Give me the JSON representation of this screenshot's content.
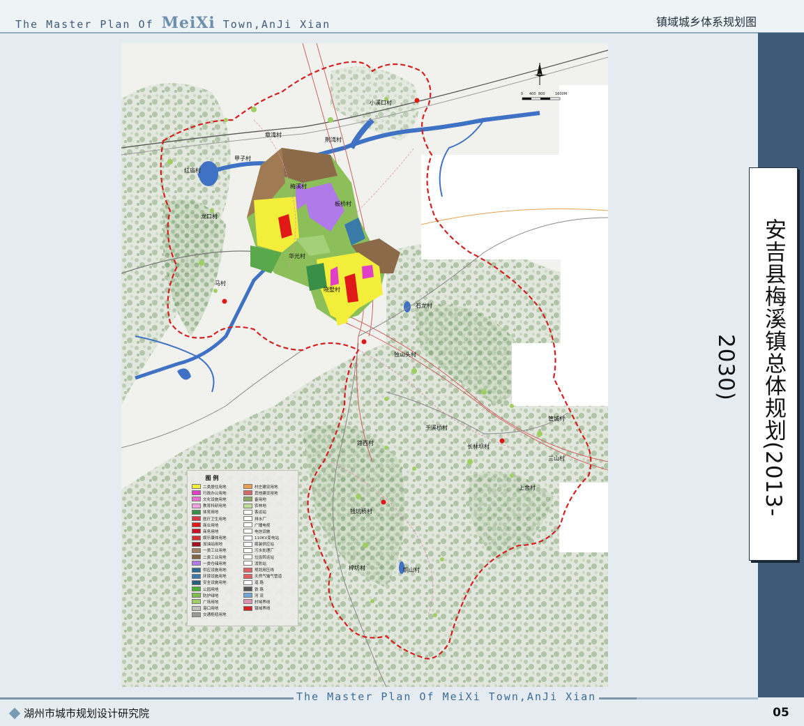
{
  "header": {
    "title_prefix": "The Master Plan Of ",
    "title_brand": "MeiXi",
    "title_suffix": " Town,AnJi Xian",
    "right_title": "镇域城乡体系规划图"
  },
  "side_title": "安吉县梅溪镇总体规划(2013-2030)",
  "map": {
    "scale_labels": [
      "0",
      "400",
      "800",
      "1600M"
    ],
    "villages": [
      {
        "name": "小溪口村"
      },
      {
        "name": "荆湾村"
      },
      {
        "name": "章湾村"
      },
      {
        "name": "甲子村"
      },
      {
        "name": "红庙村"
      },
      {
        "name": "梅溪村"
      },
      {
        "name": "板桥村"
      },
      {
        "name": "龙口村"
      },
      {
        "name": "华光村"
      },
      {
        "name": "晓墅村"
      },
      {
        "name": "马村"
      },
      {
        "name": "石龙村"
      },
      {
        "name": "独山头村"
      },
      {
        "name": "管城村"
      },
      {
        "name": "千溪桥村"
      },
      {
        "name": "长林坝村"
      },
      {
        "name": "路西村"
      },
      {
        "name": "三山村"
      },
      {
        "name": "上舍村"
      },
      {
        "name": "钱坑桥村"
      },
      {
        "name": "梓坊村"
      },
      {
        "name": "铜山村"
      }
    ],
    "legend": {
      "title": "图  例",
      "left": [
        {
          "label": "二类居住用地",
          "color": "#f2ee3a"
        },
        {
          "label": "行政办公用地",
          "color": "#e040c8"
        },
        {
          "label": "文化设施用地",
          "color": "#e86fd0"
        },
        {
          "label": "教育科研用地",
          "color": "#f3a2e0"
        },
        {
          "label": "体育用地",
          "color": "#3a8f48"
        },
        {
          "label": "医疗卫生用地",
          "color": "#d63848"
        },
        {
          "label": "商业用地",
          "color": "#e01818"
        },
        {
          "label": "商务用地",
          "color": "#c8102a"
        },
        {
          "label": "娱乐康体用地",
          "color": "#d43232"
        },
        {
          "label": "加油站用地",
          "color": "#a51020"
        },
        {
          "label": "一类工业用地",
          "color": "#a08064"
        },
        {
          "label": "二类工业用地",
          "color": "#866442"
        },
        {
          "label": "一类仓储用地",
          "color": "#b07ae8"
        },
        {
          "label": "供应设施用地",
          "color": "#2a6a90"
        },
        {
          "label": "环境设施用地",
          "color": "#3a7aa8"
        },
        {
          "label": "安全设施用地",
          "color": "#2a5f7a"
        },
        {
          "label": "公园用地",
          "color": "#4caf3a"
        },
        {
          "label": "防护绿地",
          "color": "#7ac04a"
        },
        {
          "label": "广场用地",
          "color": "#9fcf60"
        },
        {
          "label": "港口用地",
          "color": "#bfbfbf"
        },
        {
          "label": "交通枢纽用地",
          "color": "#9a9a9a"
        }
      ],
      "right": [
        {
          "label": "村庄建设用地",
          "color": "#e8a050"
        },
        {
          "label": "其他建设用地",
          "color": "#d46a6a"
        },
        {
          "label": "备用地",
          "color": "#8aa860"
        },
        {
          "label": "农林地",
          "color": "#bfe09a"
        },
        {
          "label": "客运站",
          "color": "#ffffff"
        },
        {
          "label": "排水厂",
          "color": "#ffffff"
        },
        {
          "label": "广播电视",
          "color": "#ffffff"
        },
        {
          "label": "电信设施",
          "color": "#ffffff"
        },
        {
          "label": "110KV变电站",
          "color": "#ffffff"
        },
        {
          "label": "瓶装供应站",
          "color": "#ffffff"
        },
        {
          "label": "污水处理厂",
          "color": "#ffffff"
        },
        {
          "label": "垃圾转运站",
          "color": "#ffffff"
        },
        {
          "label": "消防站",
          "color": "#ffffff"
        },
        {
          "label": "规划用压线",
          "color": "#e06060"
        },
        {
          "label": "天然气输气管道",
          "color": "#e06060"
        },
        {
          "label": "道  路",
          "color": "#ffffff"
        },
        {
          "label": "铁  路",
          "color": "#555555"
        },
        {
          "label": "河  流",
          "color": "#6fa6d6"
        },
        {
          "label": "村域界线",
          "color": "#e090b0"
        },
        {
          "label": "镇域界线",
          "color": "#d42020"
        }
      ]
    }
  },
  "footer": {
    "title": "The Master Plan Of MeiXi Town,AnJi Xian",
    "org": "湖州市城市规划设计研究院",
    "page": "05"
  },
  "colors": {
    "panel": "#3d5a78",
    "boundary": "#d42020",
    "water": "#3f72c4",
    "residential": "#f2ee3a",
    "industrial": "#8a6a48",
    "warehouse": "#b07ae8",
    "farmland": "#8cbf5a"
  }
}
